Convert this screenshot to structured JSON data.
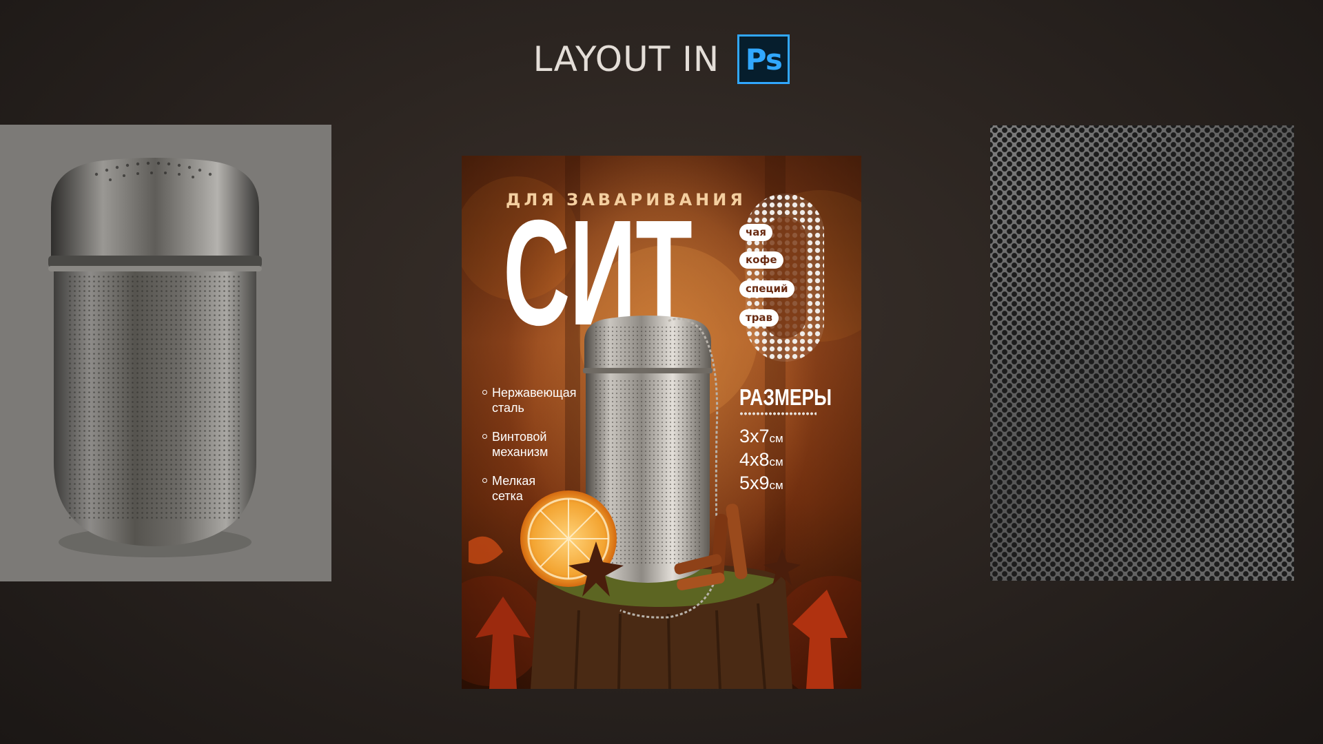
{
  "header": {
    "title": "LAYOUT IN",
    "app_logo": "Ps",
    "app_logo_colors": {
      "background": "#061e2d",
      "accent": "#31a8ff"
    }
  },
  "left_panel": {
    "image": "stainless-steel-infuser-photo",
    "background": "#7c7a77"
  },
  "right_panel": {
    "image": "perforated-metal-texture"
  },
  "poster": {
    "subtitle": "ДЛЯ ЗАВАРИВАНИЯ",
    "title": "СИТ",
    "uses": [
      "чая",
      "кофе",
      "специй",
      "трав"
    ],
    "features": [
      {
        "line1": "Нержавеющая",
        "line2": "сталь"
      },
      {
        "line1": "Винтовой",
        "line2": "механизм"
      },
      {
        "line1": "Мелкая",
        "line2": "сетка"
      }
    ],
    "sizes_title": "РАЗМЕРЫ",
    "sizes": [
      {
        "value": "3x7",
        "unit": "см"
      },
      {
        "value": "4x8",
        "unit": "см"
      },
      {
        "value": "5x9",
        "unit": "см"
      }
    ],
    "decorations": [
      "orange-slice-icon",
      "star-anise-icon",
      "cinnamon-sticks-icon",
      "tree-stump-icon",
      "autumn-leaves-icon"
    ]
  }
}
